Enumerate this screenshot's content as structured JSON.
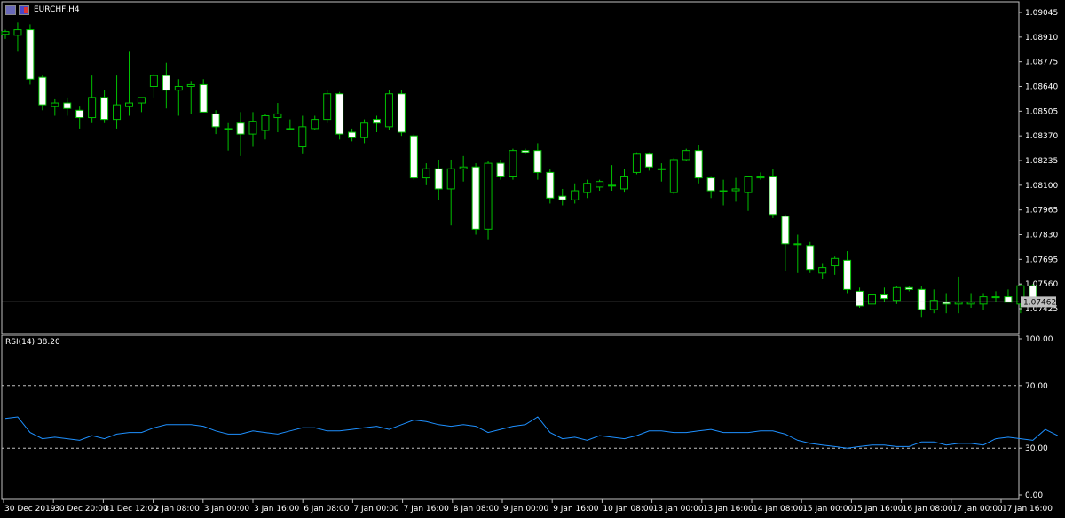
{
  "symbol_title": "EURCHF,H4",
  "rsi_label": "RSI(14) 38.20",
  "colors": {
    "background": "#000000",
    "bull_fill": "#000000",
    "bear_fill": "#ffffff",
    "wick": "#00c000",
    "rsi_line": "#1e90ff",
    "grid": "#c0c0c0",
    "bid_line": "#c0c0c0",
    "bid_box": "#c0c0c0"
  },
  "icons": [
    "chart-window-icon",
    "symbol-flag-icon"
  ],
  "chart_data": [
    {
      "type": "candlestick",
      "title": "EURCHF,H4",
      "price_ticks": [
        "1.09045",
        "1.08910",
        "1.08775",
        "1.08640",
        "1.08505",
        "1.08370",
        "1.08235",
        "1.08100",
        "1.07965",
        "1.07830",
        "1.07695",
        "1.07560",
        "1.07425"
      ],
      "ylim": [
        1.0736,
        1.091
      ],
      "current_price": "1.07462",
      "x_labels": [
        "30 Dec 2019",
        "30 Dec 20:00",
        "31 Dec 12:00",
        "2 Jan 08:00",
        "3 Jan 00:00",
        "3 Jan 16:00",
        "6 Jan 08:00",
        "7 Jan 00:00",
        "7 Jan 16:00",
        "8 Jan 08:00",
        "9 Jan 00:00",
        "9 Jan 16:00",
        "10 Jan 08:00",
        "13 Jan 00:00",
        "13 Jan 16:00",
        "14 Jan 08:00",
        "15 Jan 00:00",
        "15 Jan 16:00",
        "16 Jan 08:00",
        "17 Jan 00:00",
        "17 Jan 16:00"
      ],
      "candles": [
        [
          1.08925,
          1.0895,
          1.089,
          1.0894
        ],
        [
          1.0892,
          1.0899,
          1.0883,
          1.0895
        ],
        [
          1.0895,
          1.0898,
          1.0865,
          1.0868
        ],
        [
          1.0869,
          1.087,
          1.0851,
          1.0854
        ],
        [
          1.0853,
          1.0857,
          1.0848,
          1.0855
        ],
        [
          1.0855,
          1.0858,
          1.0848,
          1.0852
        ],
        [
          1.0851,
          1.0853,
          1.0841,
          1.0847
        ],
        [
          1.0847,
          1.087,
          1.0844,
          1.0858
        ],
        [
          1.0858,
          1.0862,
          1.0844,
          1.0846
        ],
        [
          1.0846,
          1.087,
          1.0841,
          1.0854
        ],
        [
          1.0853,
          1.0883,
          1.0848,
          1.0855
        ],
        [
          1.0855,
          1.0857,
          1.085,
          1.0858
        ],
        [
          1.0864,
          1.0871,
          1.0858,
          1.087
        ],
        [
          1.087,
          1.0877,
          1.0852,
          1.0862
        ],
        [
          1.0862,
          1.0868,
          1.0848,
          1.0864
        ],
        [
          1.0864,
          1.0867,
          1.0849,
          1.0865
        ],
        [
          1.0865,
          1.0868,
          1.085,
          1.085
        ],
        [
          1.0849,
          1.0851,
          1.0838,
          1.0842
        ],
        [
          1.0841,
          1.0844,
          1.0829,
          1.0841
        ],
        [
          1.0844,
          1.085,
          1.0826,
          1.0838
        ],
        [
          1.0838,
          1.085,
          1.0831,
          1.0845
        ],
        [
          1.084,
          1.0849,
          1.0835,
          1.0848
        ],
        [
          1.0847,
          1.0855,
          1.0839,
          1.0849
        ],
        [
          1.0841,
          1.0846,
          1.0841,
          1.0841
        ],
        [
          1.0831,
          1.0848,
          1.0827,
          1.0842
        ],
        [
          1.0841,
          1.0848,
          1.084,
          1.0846
        ],
        [
          1.0846,
          1.0862,
          1.0844,
          1.086
        ],
        [
          1.086,
          1.0861,
          1.0835,
          1.0838
        ],
        [
          1.0839,
          1.0841,
          1.0834,
          1.0836
        ],
        [
          1.0836,
          1.0846,
          1.0833,
          1.0844
        ],
        [
          1.0846,
          1.0848,
          1.0839,
          1.0844
        ],
        [
          1.0842,
          1.0862,
          1.084,
          1.086
        ],
        [
          1.086,
          1.0862,
          1.0837,
          1.0839
        ],
        [
          1.0837,
          1.0838,
          1.0813,
          1.0814
        ],
        [
          1.0814,
          1.0822,
          1.081,
          1.0819
        ],
        [
          1.0819,
          1.0824,
          1.0802,
          1.0808
        ],
        [
          1.0808,
          1.0824,
          1.0788,
          1.0819
        ],
        [
          1.0819,
          1.0826,
          1.0812,
          1.082
        ],
        [
          1.082,
          1.0822,
          1.0783,
          1.0786
        ],
        [
          1.0786,
          1.0823,
          1.078,
          1.0822
        ],
        [
          1.0822,
          1.0824,
          1.0813,
          1.0815
        ],
        [
          1.0815,
          1.083,
          1.0813,
          1.0829
        ],
        [
          1.0829,
          1.083,
          1.0827,
          1.0828
        ],
        [
          1.0829,
          1.0833,
          1.0813,
          1.0817
        ],
        [
          1.0817,
          1.0819,
          1.08,
          1.0803
        ],
        [
          1.0804,
          1.0808,
          1.0799,
          1.0802
        ],
        [
          1.0802,
          1.0811,
          1.08,
          1.0807
        ],
        [
          1.0806,
          1.0813,
          1.0803,
          1.0811
        ],
        [
          1.0809,
          1.0813,
          1.0807,
          1.0812
        ],
        [
          1.081,
          1.0821,
          1.0807,
          1.081
        ],
        [
          1.0808,
          1.0819,
          1.0806,
          1.0815
        ],
        [
          1.0817,
          1.0828,
          1.0816,
          1.0827
        ],
        [
          1.0827,
          1.0828,
          1.0818,
          1.082
        ],
        [
          1.0819,
          1.0822,
          1.0812,
          1.0819
        ],
        [
          1.0806,
          1.0825,
          1.0805,
          1.0824
        ],
        [
          1.0824,
          1.083,
          1.0823,
          1.0829
        ],
        [
          1.0829,
          1.0832,
          1.0811,
          1.0814
        ],
        [
          1.0814,
          1.0815,
          1.0803,
          1.0807
        ],
        [
          1.0807,
          1.0813,
          1.0799,
          1.0807
        ],
        [
          1.0807,
          1.0814,
          1.0801,
          1.0808
        ],
        [
          1.0806,
          1.0815,
          1.0796,
          1.0815
        ],
        [
          1.0814,
          1.0817,
          1.0813,
          1.0815
        ],
        [
          1.0815,
          1.0819,
          1.0792,
          1.0794
        ],
        [
          1.0793,
          1.0794,
          1.0763,
          1.0778
        ],
        [
          1.0778,
          1.0783,
          1.0762,
          1.0778
        ],
        [
          1.0777,
          1.0779,
          1.0762,
          1.0764
        ],
        [
          1.0762,
          1.0767,
          1.0759,
          1.0765
        ],
        [
          1.0766,
          1.0771,
          1.0761,
          1.077
        ],
        [
          1.0769,
          1.0774,
          1.0751,
          1.0753
        ],
        [
          1.0752,
          1.0754,
          1.0743,
          1.0744
        ],
        [
          1.0745,
          1.0763,
          1.0744,
          1.075
        ],
        [
          1.075,
          1.0754,
          1.0746,
          1.0748
        ],
        [
          1.0747,
          1.0755,
          1.0745,
          1.0754
        ],
        [
          1.0754,
          1.0755,
          1.0752,
          1.0753
        ],
        [
          1.0753,
          1.0755,
          1.0738,
          1.0742
        ],
        [
          1.0742,
          1.0753,
          1.074,
          1.0747
        ],
        [
          1.0746,
          1.0751,
          1.074,
          1.0745
        ],
        [
          1.0745,
          1.076,
          1.074,
          1.0746
        ],
        [
          1.0745,
          1.0751,
          1.0743,
          1.0746
        ],
        [
          1.0745,
          1.0751,
          1.0742,
          1.0749
        ],
        [
          1.0749,
          1.0752,
          1.0746,
          1.0749
        ],
        [
          1.0749,
          1.0753,
          1.0746,
          1.0746
        ],
        [
          1.0745,
          1.0756,
          1.074,
          1.0755
        ],
        [
          1.0755,
          1.0756,
          1.0745,
          1.0748
        ]
      ]
    },
    {
      "type": "line",
      "title": "RSI(14) 38.20",
      "ylim": [
        0,
        100
      ],
      "y_ticks": [
        "100.00",
        "70.00",
        "30.00",
        "0.00"
      ],
      "levels": [
        70,
        30
      ],
      "series": [
        {
          "name": "RSI(14)",
          "values": [
            49,
            50,
            40,
            36,
            37,
            36,
            35,
            38,
            36,
            39,
            40,
            40,
            43,
            45,
            45,
            45,
            44,
            41,
            39,
            39,
            41,
            40,
            39,
            41,
            43,
            43,
            41,
            41,
            42,
            43,
            44,
            42,
            45,
            48,
            47,
            45,
            44,
            45,
            44,
            40,
            42,
            44,
            45,
            50,
            40,
            36,
            37,
            35,
            38,
            37,
            36,
            38,
            41,
            41,
            40,
            40,
            41,
            42,
            40,
            40,
            40,
            41,
            41,
            39,
            35,
            33,
            32,
            31,
            30,
            31,
            32,
            32,
            31,
            31,
            34,
            34,
            32,
            33,
            33,
            32,
            36,
            37,
            36,
            35,
            42,
            38
          ]
        }
      ]
    }
  ]
}
